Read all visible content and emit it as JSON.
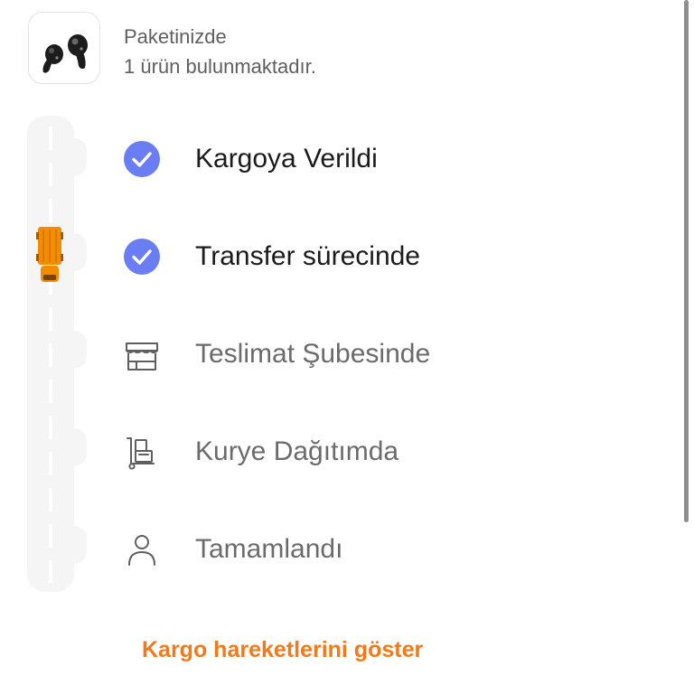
{
  "package": {
    "line1": "Paketinizde",
    "line2": "1 ürün bulunmaktadır.",
    "product_icon": "earbuds-image"
  },
  "steps": [
    {
      "label": "Kargoya Verildi",
      "status": "done",
      "icon": "check-circle-icon"
    },
    {
      "label": "Transfer sürecinde",
      "status": "done",
      "icon": "check-circle-icon"
    },
    {
      "label": "Teslimat Şubesinde",
      "status": "pending",
      "icon": "store-icon"
    },
    {
      "label": "Kurye Dağıtımda",
      "status": "pending",
      "icon": "courier-trolley-icon"
    },
    {
      "label": "Tamamlandı",
      "status": "pending",
      "icon": "person-icon"
    }
  ],
  "current_step": 2,
  "cta": {
    "label": "Kargo hareketlerini göster"
  },
  "colors": {
    "accent": "#f27a1a",
    "check": "#6b7df2",
    "truck": "#f28c00",
    "road": "#f5f5f5",
    "pending_text": "#6b6b6b",
    "done_text": "#1b1b1b"
  }
}
